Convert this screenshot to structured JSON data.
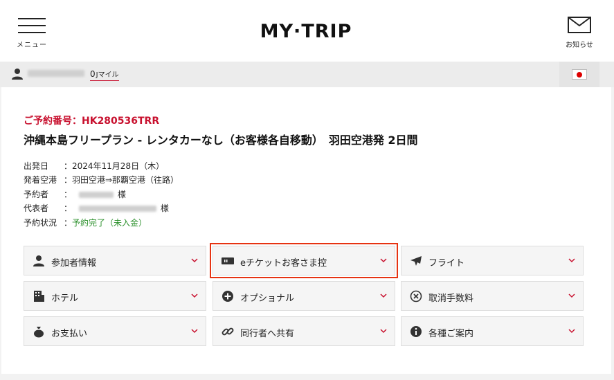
{
  "header": {
    "menu_label": "メニュー",
    "logo_text": "MY·TRIP",
    "notice_label": "お知らせ"
  },
  "userbar": {
    "mile_value": "0",
    "mile_unit": "Jマイル"
  },
  "reservation": {
    "number_label": "ご予約番号：HK280536TRR",
    "title": "沖縄本島フリープラン - レンタカーなし（お客様各自移動）　羽田空港発 2日間",
    "rows": [
      {
        "key": "出発日",
        "value": "：2024年11月28日（木）"
      },
      {
        "key": "発着空港",
        "value": "：羽田空港⇒那覇空港（往路）"
      },
      {
        "key": "予約者",
        "value": "：",
        "suffix": "様"
      },
      {
        "key": "代表者",
        "value": "：",
        "suffix": "様"
      },
      {
        "key": "予約状況",
        "value": "：",
        "status": "予約完了（未入金）"
      }
    ]
  },
  "tiles": [
    {
      "label": "参加者情報",
      "icon": "user-icon"
    },
    {
      "label": "eチケットお客さま控",
      "icon": "ticket-icon"
    },
    {
      "label": "フライト",
      "icon": "airplane-icon"
    },
    {
      "label": "ホテル",
      "icon": "hotel-icon"
    },
    {
      "label": "オプショナル",
      "icon": "plus-circle-icon"
    },
    {
      "label": "取消手数料",
      "icon": "x-circle-icon"
    },
    {
      "label": "お支払い",
      "icon": "money-bag-icon"
    },
    {
      "label": "同行者へ共有",
      "icon": "link-icon"
    },
    {
      "label": "各種ご案内",
      "icon": "info-icon"
    }
  ],
  "colors": {
    "accent_red": "#c8102e",
    "status_green": "#2a8f2a",
    "highlight": "#e63312"
  }
}
